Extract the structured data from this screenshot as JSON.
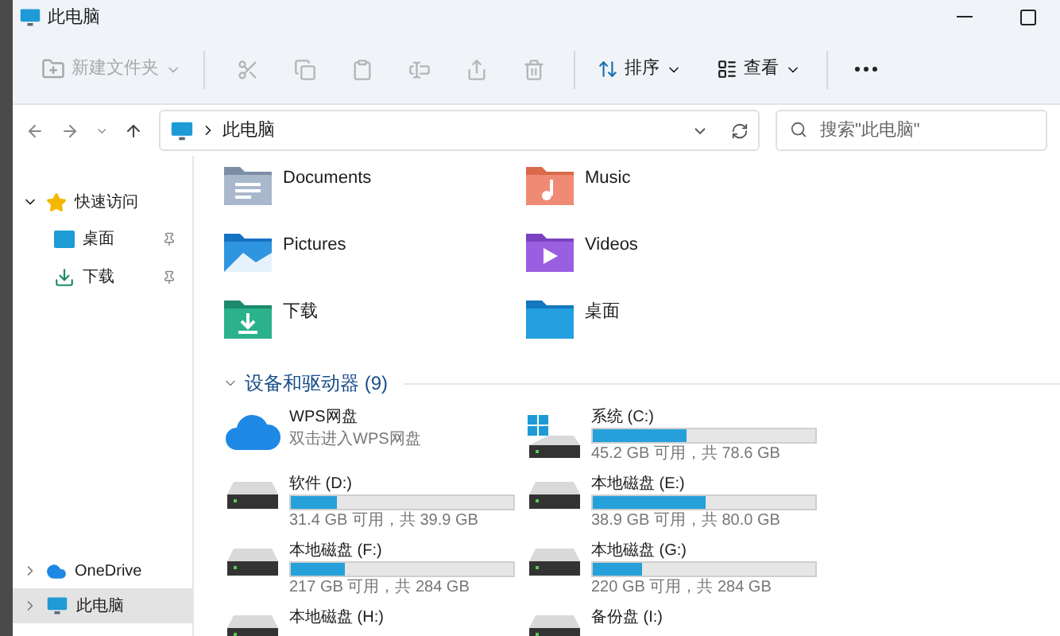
{
  "window": {
    "title": "此电脑"
  },
  "toolbar": {
    "new_folder": {
      "label": "新建文件夹",
      "disabled": true
    },
    "actions": [
      {
        "kind": "cut",
        "disabled": true
      },
      {
        "kind": "copy",
        "disabled": true
      },
      {
        "kind": "paste",
        "disabled": true
      },
      {
        "kind": "rename",
        "disabled": true
      },
      {
        "kind": "share",
        "disabled": true
      },
      {
        "kind": "delete",
        "disabled": true
      }
    ],
    "sort": {
      "label": "排序"
    },
    "view": {
      "label": "查看"
    }
  },
  "address": {
    "path": "此电脑"
  },
  "search": {
    "placeholder": "搜索\"此电脑\""
  },
  "sidebar": {
    "items": [
      {
        "kind": "star",
        "label": "快速访问",
        "expanded": true,
        "selected": false,
        "children": [
          {
            "kind": "desktop",
            "label": "桌面",
            "pinned": true
          },
          {
            "kind": "download",
            "label": "下载",
            "pinned": true
          }
        ]
      },
      {
        "kind": "cloud",
        "label": "OneDrive",
        "expanded": false,
        "selected": false
      },
      {
        "kind": "pc",
        "label": "此电脑",
        "expanded": false,
        "selected": true
      }
    ]
  },
  "folders": [
    {
      "kind": "documents",
      "name": "Documents"
    },
    {
      "kind": "music",
      "name": "Music"
    },
    {
      "kind": "pictures",
      "name": "Pictures"
    },
    {
      "kind": "videos",
      "name": "Videos"
    },
    {
      "kind": "download",
      "name": "下载"
    },
    {
      "kind": "desktop",
      "name": "桌面"
    }
  ],
  "devices": {
    "title": "设备和驱动器 (9)",
    "expanded": true,
    "items": [
      {
        "kind": "cloud",
        "name": "WPS网盘",
        "subtitle": "双击进入WPS网盘"
      },
      {
        "kind": "system",
        "name": "系统 (C:)",
        "level": 0.42,
        "free": "45.2 GB 可用，共 78.6 GB"
      },
      {
        "kind": "disk",
        "name": "软件 (D:)",
        "level": 0.21,
        "free": "31.4 GB 可用，共 39.9 GB"
      },
      {
        "kind": "disk",
        "name": "本地磁盘 (E:)",
        "level": 0.51,
        "free": "38.9 GB 可用，共 80.0 GB"
      },
      {
        "kind": "disk",
        "name": "本地磁盘 (F:)",
        "level": 0.24,
        "free": "217 GB 可用，共 284 GB"
      },
      {
        "kind": "disk",
        "name": "本地磁盘 (G:)",
        "level": 0.22,
        "free": "220 GB 可用，共 284 GB"
      },
      {
        "kind": "disk",
        "name": "本地磁盘 (H:)"
      },
      {
        "kind": "disk",
        "name": "备份盘 (I:)"
      }
    ]
  }
}
